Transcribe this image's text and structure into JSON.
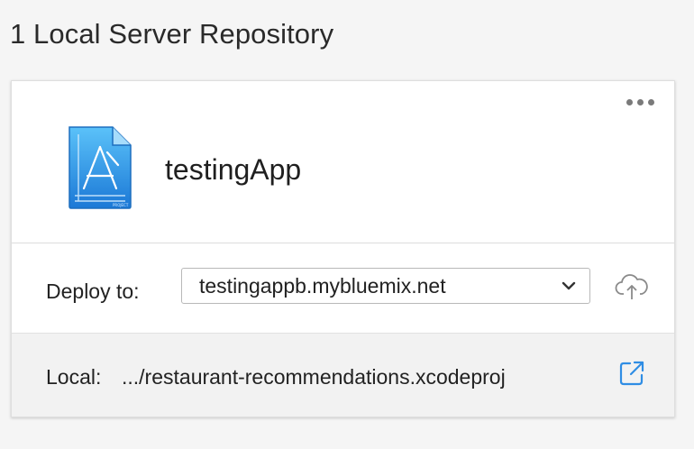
{
  "header": {
    "title": "1 Local Server Repository"
  },
  "repository": {
    "app_name": "testingApp",
    "app_icon": "xcode-project-icon",
    "more_icon": "more-ellipsis-icon",
    "deploy": {
      "label": "Deploy to:",
      "selected": "testingappb.mybluemix.net",
      "dropdown_icon": "chevron-down-icon",
      "action_icon": "cloud-upload-icon"
    },
    "local": {
      "label": "Local:",
      "path": ".../restaurant-recommendations.xcodeproj",
      "action_icon": "open-external-icon"
    }
  },
  "colors": {
    "accent": "#2f8de4",
    "icon_gray": "#7a7a7a",
    "band": "#f2f2f2"
  }
}
